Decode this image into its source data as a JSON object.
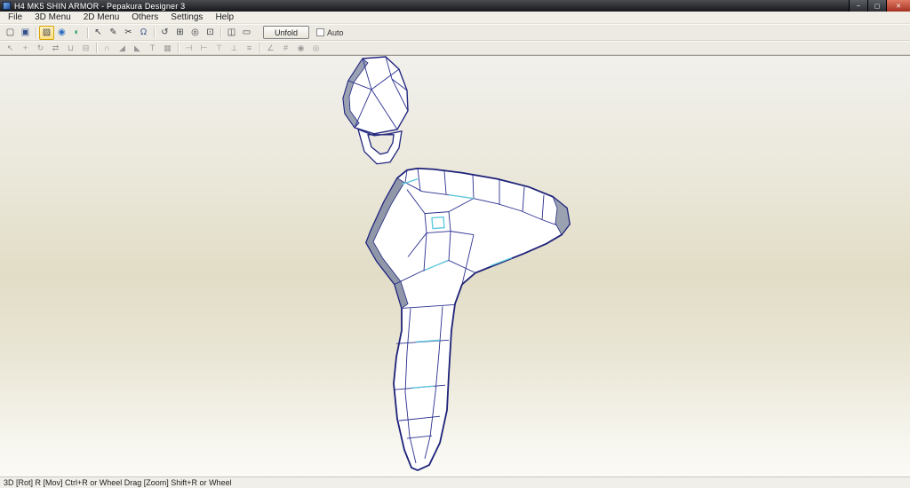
{
  "window": {
    "title": "H4 MK5 SHIN ARMOR - Pepakura Designer 3",
    "controls": {
      "minimize": "–",
      "maximize": "▢",
      "close": "✕"
    }
  },
  "menu": {
    "items": [
      {
        "label": "File"
      },
      {
        "label": "3D Menu"
      },
      {
        "label": "2D Menu"
      },
      {
        "label": "Others"
      },
      {
        "label": "Settings"
      },
      {
        "label": "Help"
      }
    ]
  },
  "toolbar": {
    "unfold_label": "Unfold",
    "auto_label": "Auto",
    "auto_checked": false,
    "row1": [
      {
        "name": "new-file-icon",
        "glyph": "▢"
      },
      {
        "name": "save-icon",
        "glyph": "▣"
      },
      {
        "name": "texture-mode-icon",
        "glyph": "▨"
      },
      {
        "name": "shaded-view-icon",
        "glyph": "◉"
      },
      {
        "name": "smooth-view-icon",
        "glyph": "◐"
      },
      {
        "name": "select-tool-icon",
        "glyph": "↖"
      },
      {
        "name": "pen-tool-icon",
        "glyph": "✎"
      },
      {
        "name": "scissors-tool-icon",
        "glyph": "✂"
      },
      {
        "name": "magnet-tool-icon",
        "glyph": "Ω"
      },
      {
        "name": "rotate-view-icon",
        "glyph": "↺"
      },
      {
        "name": "pan-view-icon",
        "glyph": "⊞"
      },
      {
        "name": "zoom-view-icon",
        "glyph": "◎"
      },
      {
        "name": "fit-view-icon",
        "glyph": "⊡"
      },
      {
        "name": "layout-split-icon",
        "glyph": "◫"
      },
      {
        "name": "layout-full-icon",
        "glyph": "▭"
      }
    ],
    "row2": [
      {
        "name": "select-part-icon",
        "glyph": "↖"
      },
      {
        "name": "move-part-icon",
        "glyph": "+"
      },
      {
        "name": "rotate-part-icon",
        "glyph": "↻"
      },
      {
        "name": "flip-part-icon",
        "glyph": "⇄"
      },
      {
        "name": "join-parts-icon",
        "glyph": "⊔"
      },
      {
        "name": "divide-part-icon",
        "glyph": "⊟"
      },
      {
        "name": "edge-join-icon",
        "glyph": "∩"
      },
      {
        "name": "add-flap-icon",
        "glyph": "◢"
      },
      {
        "name": "remove-flap-icon",
        "glyph": "◣"
      },
      {
        "name": "text-tool-icon",
        "glyph": "T"
      },
      {
        "name": "image-tool-icon",
        "glyph": "▦"
      },
      {
        "name": "align-left-icon",
        "glyph": "⊣"
      },
      {
        "name": "align-right-icon",
        "glyph": "⊢"
      },
      {
        "name": "align-top-icon",
        "glyph": "⊤"
      },
      {
        "name": "align-bottom-icon",
        "glyph": "⊥"
      },
      {
        "name": "distribute-icon",
        "glyph": "≡"
      },
      {
        "name": "measure-icon",
        "glyph": "∠"
      },
      {
        "name": "grid-icon",
        "glyph": "#"
      },
      {
        "name": "snap-icon",
        "glyph": "◉"
      },
      {
        "name": "zoom-2d-icon",
        "glyph": "◎"
      }
    ]
  },
  "statusbar": {
    "text": "3D [Rot] R [Mov] Ctrl+R or Wheel Drag [Zoom] Shift+R or Wheel"
  },
  "colors": {
    "titlebar": "#1e1f23",
    "close_button": "#a63122",
    "toolbar_bg": "#edeae3",
    "viewport_mid": "#e2ddc6",
    "model_edge": "#23277f",
    "model_open_edge": "#63cade",
    "model_thickness": "#8f97a9"
  }
}
